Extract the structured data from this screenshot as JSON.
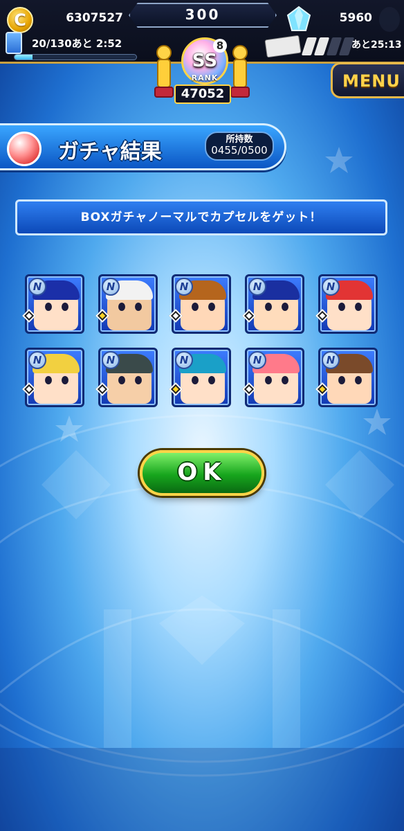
{
  "header": {
    "coins": "6307527",
    "center_value": "300",
    "gems": "5960",
    "stamina_text": "20/130あと 2:52",
    "stamina_fraction": 0.15,
    "ticket_timer": "あと25:13",
    "rank_grade": "SS",
    "rank_sub": "8",
    "rank_label": "RANK",
    "rank_value": "47052",
    "menu_label": "MENU"
  },
  "title": {
    "text": "ガチャ結果",
    "owned_label": "所持数",
    "owned_value": "0455/0500"
  },
  "message": "BOXガチャノーマルでカプセルをゲット！",
  "capsules": [
    {
      "badge": "N",
      "hair": "#1b2fa8",
      "skin": "#ffe0c8",
      "diamond": "white"
    },
    {
      "badge": "N",
      "hair": "#f2f2f2",
      "skin": "#f2c9a0",
      "diamond": "yellow"
    },
    {
      "badge": "N",
      "hair": "#b5651d",
      "skin": "#ffd8b8",
      "diamond": "white"
    },
    {
      "badge": "N",
      "hair": "#1a2fa0",
      "skin": "#ffdcbc",
      "diamond": "white"
    },
    {
      "badge": "N",
      "hair": "#e23434",
      "skin": "#ffe0c8",
      "diamond": "white"
    },
    {
      "badge": "N",
      "hair": "#f2d040",
      "skin": "#ffe0c8",
      "diamond": "white"
    },
    {
      "badge": "N",
      "hair": "#3a4a4a",
      "skin": "#f6cfa8",
      "diamond": "white"
    },
    {
      "badge": "N",
      "hair": "#1aa0c8",
      "skin": "#ffe0c8",
      "diamond": "yellow"
    },
    {
      "badge": "N",
      "hair": "#ff7a8a",
      "skin": "#ffe0c8",
      "diamond": "white"
    },
    {
      "badge": "N",
      "hair": "#7a4a2a",
      "skin": "#ffd8b8",
      "diamond": "yellow"
    }
  ],
  "ok_label": "OK",
  "icons": {
    "coin": "coin-icon",
    "coin_glyph": "C",
    "gem": "diamond-gem-icon",
    "stamina": "stamina-card-icon",
    "ticket": "baseball-ticket-icon",
    "title": "capsule-icon"
  },
  "colors": {
    "accent_gold": "#ffd447",
    "banner_blue": "#0b56c4",
    "ok_green": "#17a51d"
  }
}
